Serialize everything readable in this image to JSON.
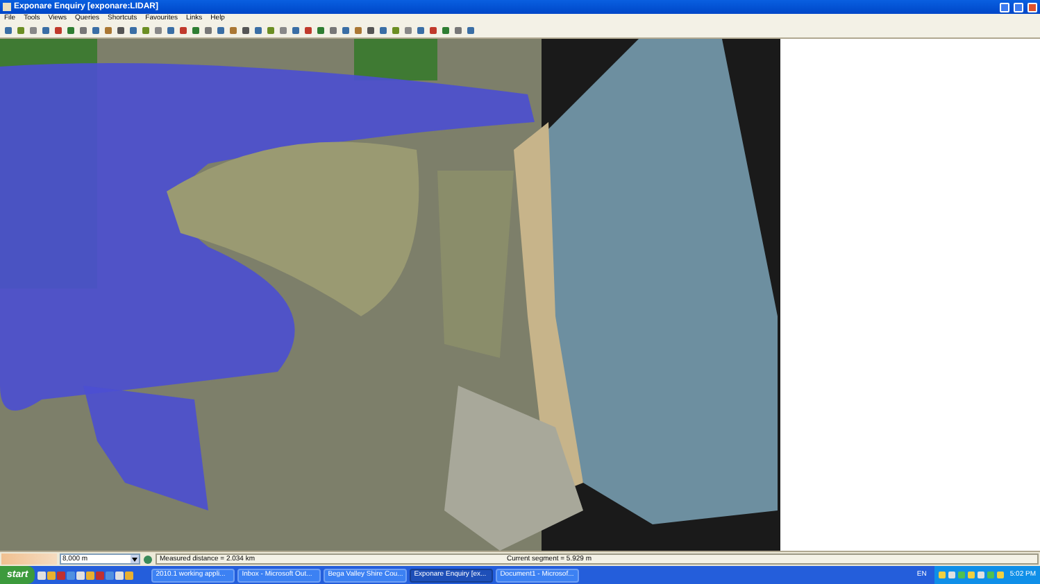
{
  "window": {
    "title": "Exponare Enquiry [exponare:LIDAR]"
  },
  "menu": [
    "File",
    "Tools",
    "Views",
    "Queries",
    "Shortcuts",
    "Favourites",
    "Links",
    "Help"
  ],
  "status_bar": {
    "scale": "8,000 m",
    "measured": "Measured distance = 2.034 km",
    "segment": "Current segment = 5.929 m"
  },
  "taskbar": {
    "start": "start",
    "items": [
      {
        "label": "2010.1 working appli...",
        "selected": false
      },
      {
        "label": "Inbox - Microsoft Out...",
        "selected": false
      },
      {
        "label": "Bega Valley Shire Cou...",
        "selected": false
      },
      {
        "label": "Exponare Enquiry [ex...",
        "selected": true
      },
      {
        "label": "Document1 - Microsof...",
        "selected": false
      }
    ],
    "language": "EN",
    "clock": "5:02 PM"
  }
}
